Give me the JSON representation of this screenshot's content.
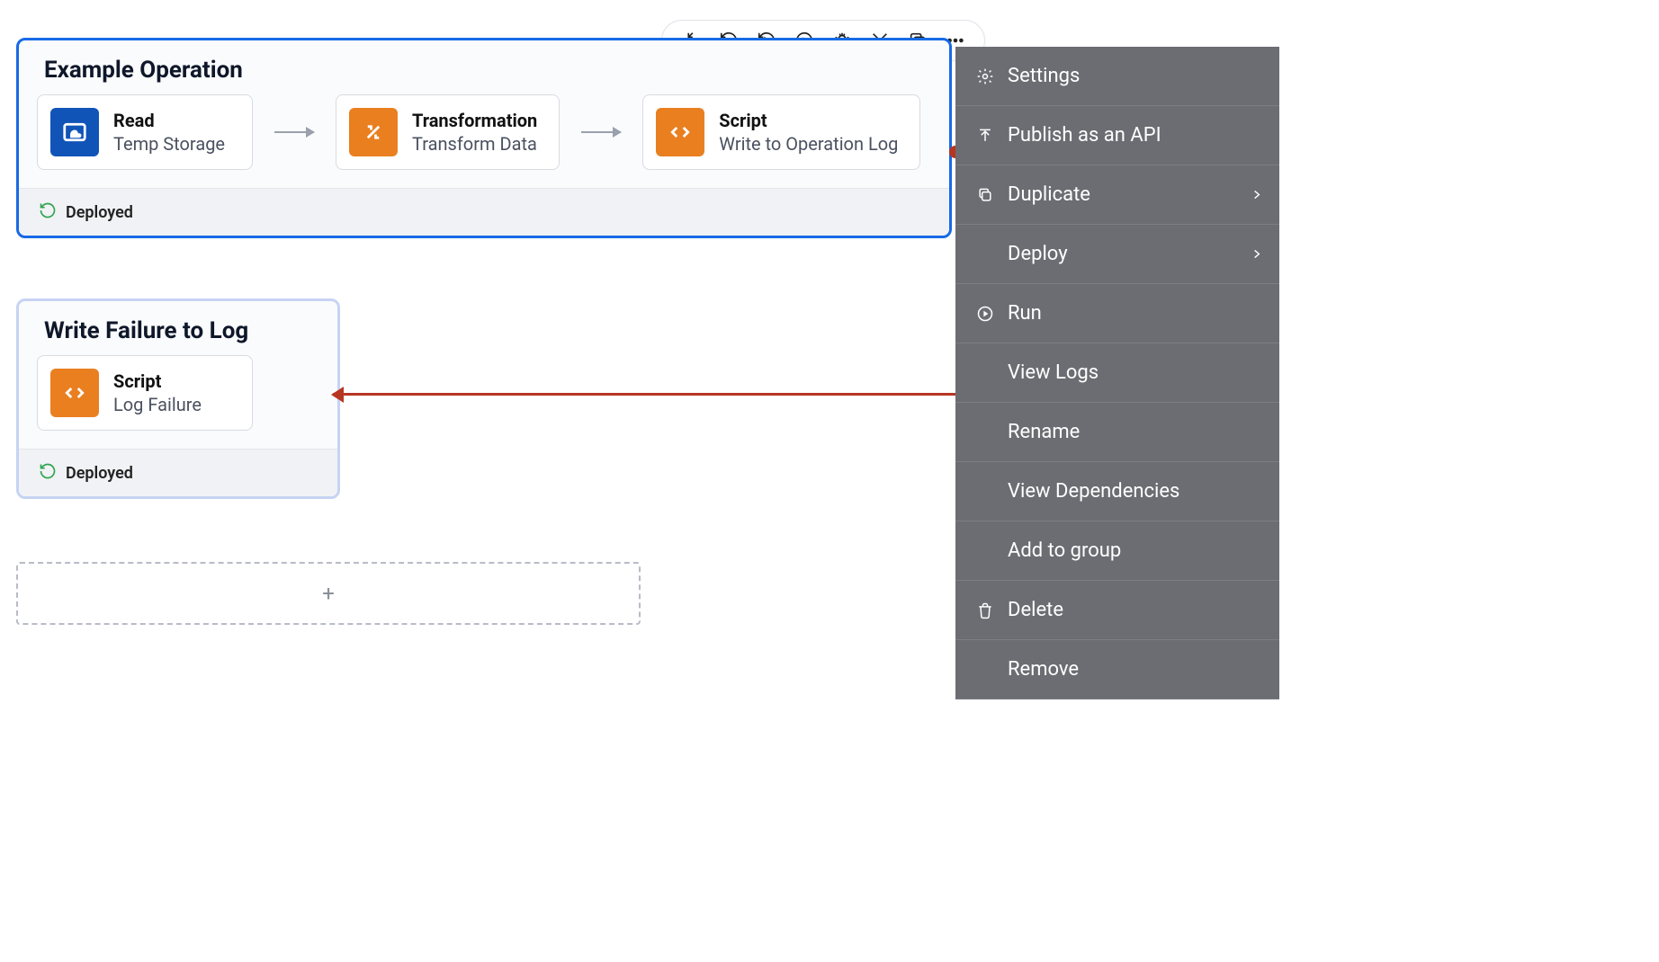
{
  "operations": {
    "primary": {
      "title": "Example Operation",
      "status": "Deployed",
      "steps": [
        {
          "type": "Read",
          "label": "Temp Storage"
        },
        {
          "type": "Transformation",
          "label": "Transform Data"
        },
        {
          "type": "Script",
          "label": "Write to Operation Log"
        }
      ]
    },
    "secondary": {
      "title": "Write Failure to Log",
      "status": "Deployed",
      "step": {
        "type": "Script",
        "label": "Log Failure"
      }
    }
  },
  "add_zone": {
    "label": "+"
  },
  "context_menu": {
    "items": [
      {
        "label": "Settings",
        "icon": "gear"
      },
      {
        "label": "Publish as an API",
        "icon": "publish"
      },
      {
        "label": "Duplicate",
        "icon": "duplicate",
        "submenu": true
      },
      {
        "label": "Deploy",
        "icon": "",
        "submenu": true
      },
      {
        "label": "Run",
        "icon": "play"
      },
      {
        "label": "View Logs",
        "icon": ""
      },
      {
        "label": "Rename",
        "icon": ""
      },
      {
        "label": "View Dependencies",
        "icon": ""
      },
      {
        "label": "Add to group",
        "icon": ""
      },
      {
        "label": "Delete",
        "icon": "trash"
      },
      {
        "label": "Remove",
        "icon": ""
      }
    ]
  },
  "colors": {
    "selection": "#186ae6",
    "secondary_border": "#c6d3f4",
    "step_orange": "#ea7f20",
    "step_blue": "#1154b8",
    "fail_connector": "#b73622",
    "menu_bg": "#6b6d72",
    "status_ok": "#2fa44f"
  }
}
